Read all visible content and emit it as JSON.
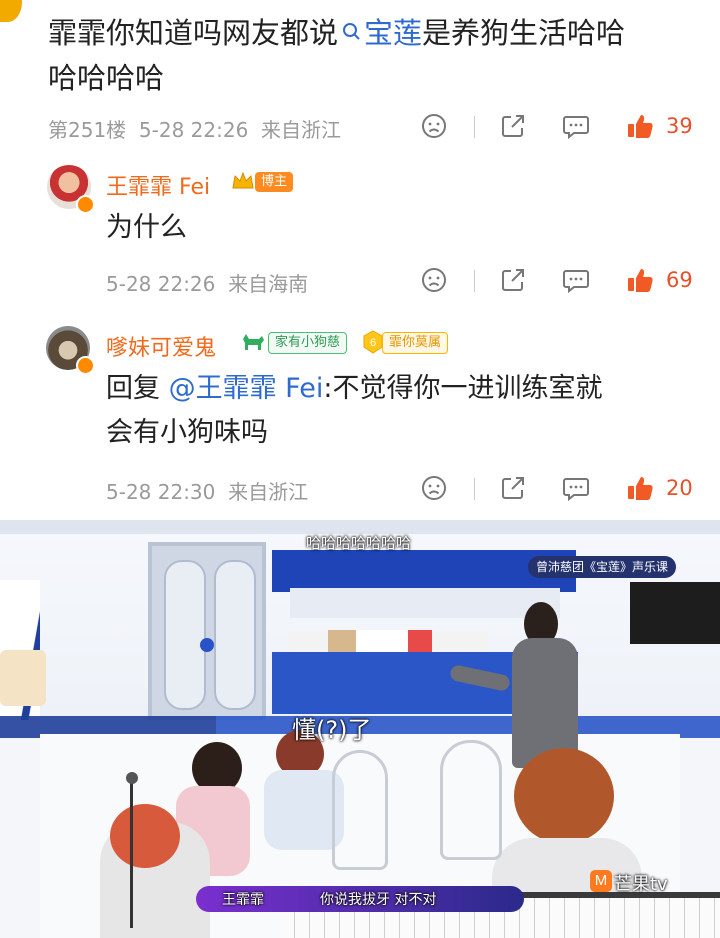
{
  "colors": {
    "accent": "#f06a1c",
    "like": "#e8502a",
    "link": "#2f6bcf",
    "meta": "#9a9a9a"
  },
  "main_comment": {
    "text_part1": "霏霏你知道吗网友都说",
    "topic": "宝莲",
    "text_part2": "是养狗生活哈哈",
    "line2": "哈哈哈哈",
    "floor": "第251楼",
    "time": "5-28 22:26",
    "location": "来自浙江",
    "like_count": "39",
    "icons": [
      "search-icon",
      "frown-icon",
      "share-icon",
      "comment-icon",
      "thumbs-up-icon"
    ]
  },
  "reply1": {
    "author": "王霏霏 Fei",
    "badge": "博主",
    "text": "为什么",
    "time": "5-28 22:26",
    "location": "来自海南",
    "like_count": "69"
  },
  "reply2": {
    "author": "嗲妹可爱鬼",
    "fan_tag": "家有小狗慈",
    "level": "6",
    "fan_group": "霏你莫属",
    "reply_prefix": "回复",
    "mention": "@王霏霏 Fei",
    "text_rest": ":不觉得你一进训练室就",
    "line2": "会有小狗味吗",
    "time": "5-28 22:30",
    "location": "来自浙江",
    "like_count": "20"
  },
  "video": {
    "top_caption": "哈哈哈哈哈哈哈",
    "program_label": "曾沛慈团《宝莲》声乐课",
    "overlay_text": "懂(?)了",
    "speaker": "王霏霏",
    "subtitle": "你说我拔牙 对不对",
    "watermark": "芒果tv"
  }
}
